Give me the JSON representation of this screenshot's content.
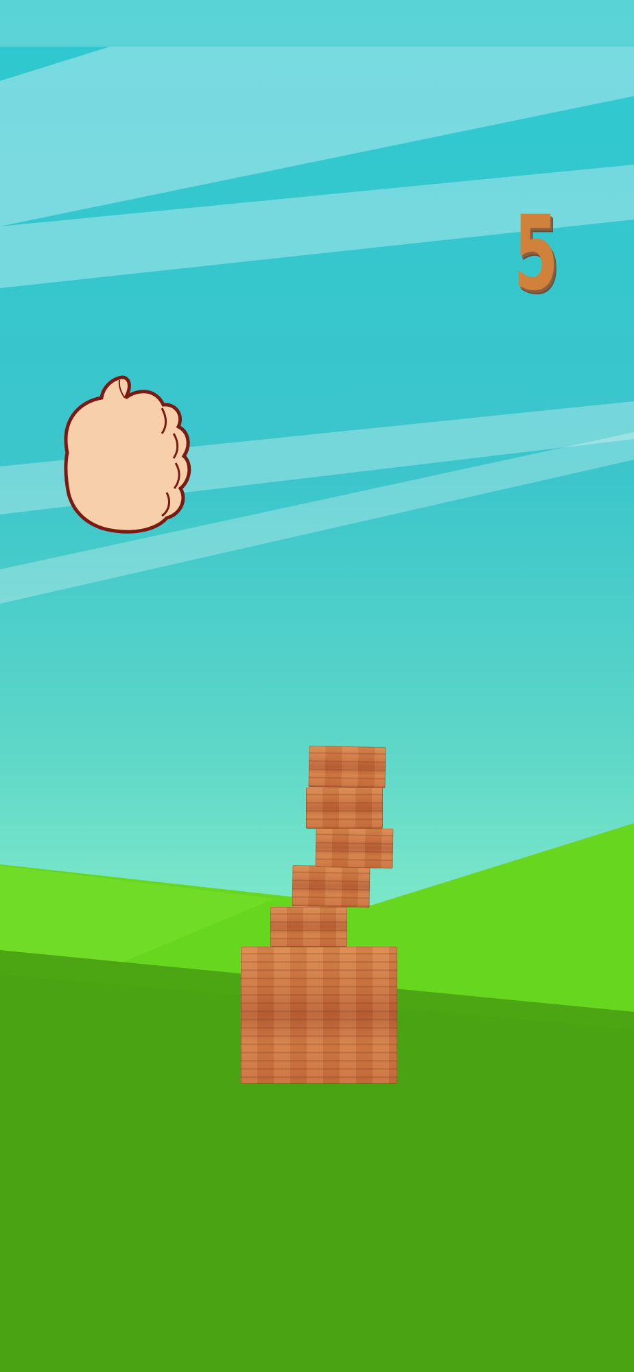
{
  "game": {
    "score": "5"
  },
  "icons": {
    "pointer": "fist-hand-icon"
  },
  "colors": {
    "sky_top": "#2ec8d0",
    "sky_bottom": "#79e6c9",
    "grass_light": "#66d61f",
    "grass_dark": "#4aa313",
    "wood": "#cc7442",
    "score_fill": "#d0823a",
    "hand_skin": "#f7cfaa",
    "hand_outline": "#7a1a12"
  }
}
